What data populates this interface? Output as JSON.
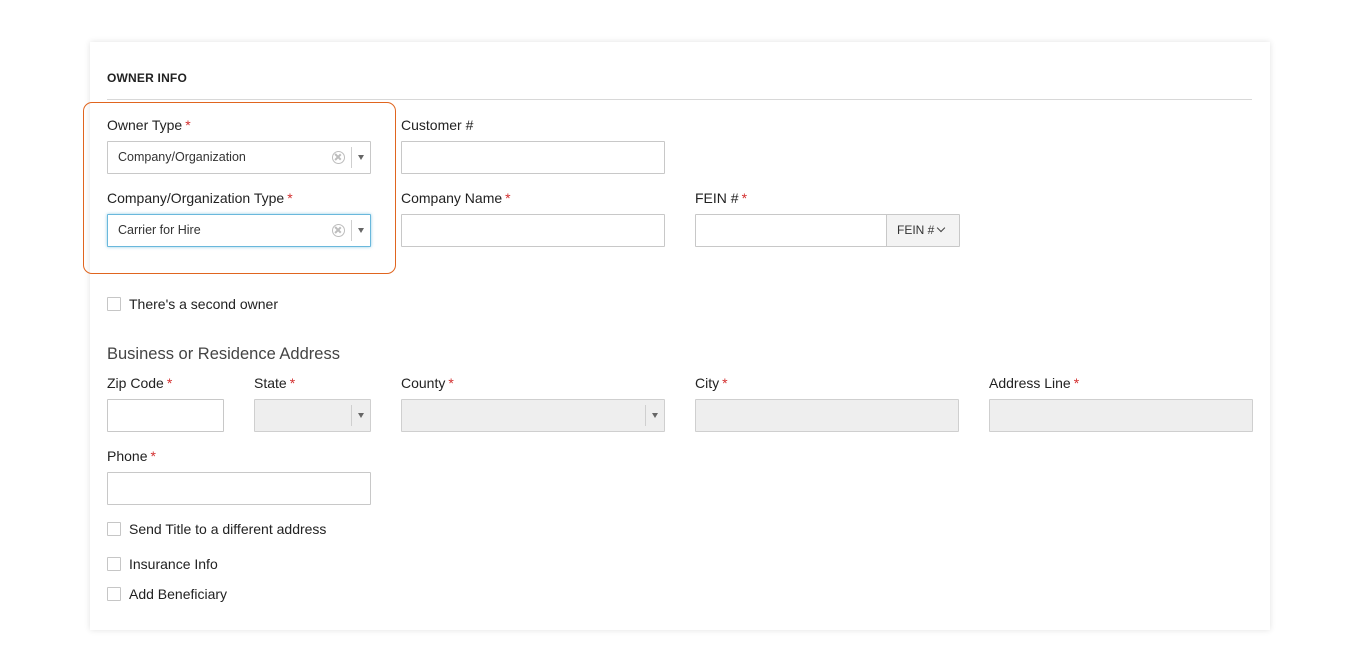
{
  "section": {
    "title": "OWNER INFO"
  },
  "owner_type": {
    "label": "Owner Type",
    "required_mark": "*",
    "value": "Company/Organization"
  },
  "customer_number": {
    "label": "Customer #",
    "value": ""
  },
  "company_org_type": {
    "label": "Company/Organization Type",
    "required_mark": "*",
    "value": "Carrier for Hire"
  },
  "company_name": {
    "label": "Company Name",
    "required_mark": "*",
    "value": ""
  },
  "fein": {
    "label": "FEIN #",
    "required_mark": "*",
    "value": "",
    "addon_label": "FEIN #"
  },
  "second_owner": {
    "label": "There's a second owner",
    "checked": false
  },
  "address": {
    "heading": "Business or Residence Address",
    "zip": {
      "label": "Zip Code",
      "required_mark": "*",
      "value": ""
    },
    "state": {
      "label": "State",
      "required_mark": "*",
      "value": ""
    },
    "county": {
      "label": "County",
      "required_mark": "*",
      "value": ""
    },
    "city": {
      "label": "City",
      "required_mark": "*",
      "value": ""
    },
    "address_line": {
      "label": "Address Line",
      "required_mark": "*",
      "value": ""
    },
    "phone": {
      "label": "Phone",
      "required_mark": "*",
      "value": ""
    }
  },
  "options": {
    "send_title": {
      "label": "Send Title to a different address",
      "checked": false
    },
    "insurance": {
      "label": "Insurance Info",
      "checked": false
    },
    "beneficiary": {
      "label": "Add Beneficiary",
      "checked": false
    }
  },
  "colors": {
    "highlight": "#e0651f",
    "required": "#d32f2f",
    "focus": "#6ab8dc"
  },
  "icons": {
    "clear": "clear-circle-icon",
    "dropdown": "caret-down-icon",
    "addon_dropdown": "chevron-down-icon"
  }
}
